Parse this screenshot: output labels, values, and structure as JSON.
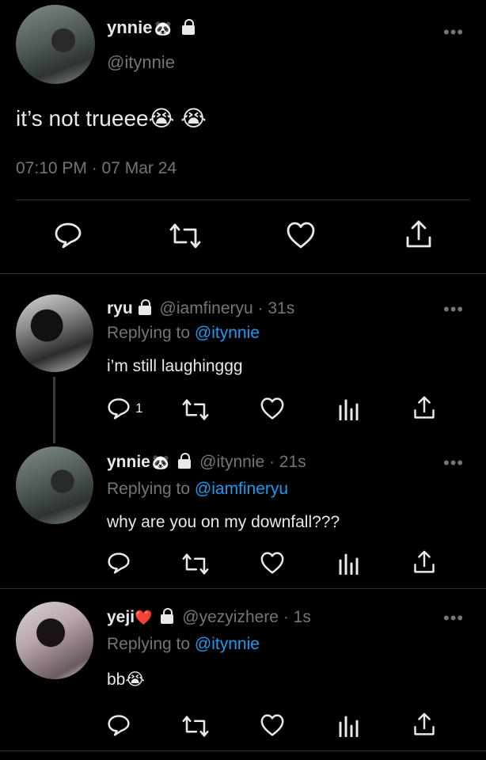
{
  "main_tweet": {
    "display_name": "ynnie",
    "name_emoji": "🐼",
    "handle": "@itynnie",
    "text": "it’s not trueee😭 😭",
    "timestamp": "07:10 PM · 07 Mar 24",
    "more": "•••"
  },
  "replies": [
    {
      "display_name": "ryu",
      "name_emoji": "",
      "handle_time": "@iamfineryu · 31s",
      "replying_prefix": "Replying to",
      "replying_to": "@itynnie",
      "text": "i’m still laughinggg",
      "reply_count": "1",
      "more": "•••"
    },
    {
      "display_name": "ynnie",
      "name_emoji": "🐼",
      "handle_time": "@itynnie · 21s",
      "replying_prefix": "Replying to",
      "replying_to": "@iamfineryu",
      "text": "why are you on my downfall???",
      "reply_count": "",
      "more": "•••"
    },
    {
      "display_name": "yeji",
      "name_emoji": "❤️",
      "handle_time": "@yezyizhere · 1s",
      "replying_prefix": "Replying to",
      "replying_to": "@itynnie",
      "text": "bb😭",
      "reply_count": "",
      "more": "•••"
    }
  ],
  "colors": {
    "background": "#000000",
    "text": "#e7e9ea",
    "muted": "#71767b",
    "link": "#1d9bf0",
    "divider": "#2f3336"
  },
  "icons": [
    "reply-icon",
    "retweet-icon",
    "like-icon",
    "analytics-icon",
    "share-icon",
    "lock-icon",
    "more-icon"
  ]
}
